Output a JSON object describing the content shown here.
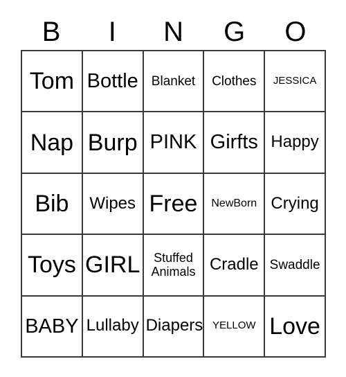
{
  "card": {
    "title_letters": [
      "B",
      "I",
      "N",
      "G",
      "O"
    ],
    "rows": [
      [
        {
          "label": "Tom",
          "size": "s-xl"
        },
        {
          "label": "Bottle",
          "size": "s-lg"
        },
        {
          "label": "Blanket",
          "size": "s-sm"
        },
        {
          "label": "Clothes",
          "size": "s-sm"
        },
        {
          "label": "JESSICA",
          "size": "s-xxs"
        }
      ],
      [
        {
          "label": "Nap",
          "size": "s-xl"
        },
        {
          "label": "Burp",
          "size": "s-xl"
        },
        {
          "label": "PINK",
          "size": "s-lg"
        },
        {
          "label": "Girfts",
          "size": "s-lg"
        },
        {
          "label": "Happy",
          "size": "s-md"
        }
      ],
      [
        {
          "label": "Bib",
          "size": "s-xl"
        },
        {
          "label": "Wipes",
          "size": "s-md"
        },
        {
          "label": "Free",
          "size": "s-xl"
        },
        {
          "label": "NewBorn",
          "size": "s-xs"
        },
        {
          "label": "Crying",
          "size": "s-md"
        }
      ],
      [
        {
          "label": "Toys",
          "size": "s-xl"
        },
        {
          "label": "GIRL",
          "size": "s-xl"
        },
        {
          "label": "Stuffed Animals",
          "size": "s-two"
        },
        {
          "label": "Cradle",
          "size": "s-md"
        },
        {
          "label": "Swaddle",
          "size": "s-sm"
        }
      ],
      [
        {
          "label": "BABY",
          "size": "s-lg"
        },
        {
          "label": "Lullaby",
          "size": "s-md"
        },
        {
          "label": "Diapers",
          "size": "s-md"
        },
        {
          "label": "YELLOW",
          "size": "s-xxs"
        },
        {
          "label": "Love",
          "size": "s-xl"
        }
      ]
    ],
    "colors": {
      "border": "#3a3a3a",
      "text": "#000000",
      "background": "#ffffff"
    }
  }
}
